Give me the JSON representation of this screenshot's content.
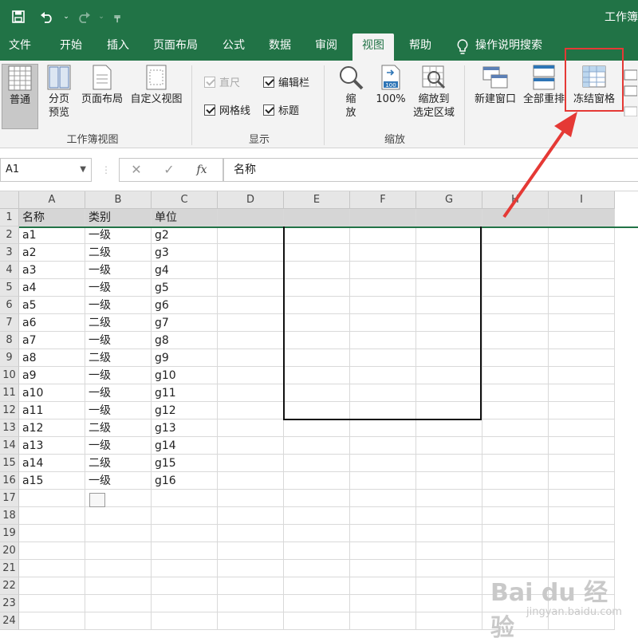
{
  "title_bar": {
    "title": "工作簿"
  },
  "tabs": [
    "文件",
    "开始",
    "插入",
    "页面布局",
    "公式",
    "数据",
    "审阅",
    "视图",
    "帮助",
    "操作说明搜索"
  ],
  "ribbon": {
    "workbook_views": {
      "normal": "普通",
      "page_break": "分页\n预览",
      "page_layout": "页面布局",
      "custom": "自定义视图",
      "label": "工作簿视图"
    },
    "show": {
      "ruler": "直尺",
      "formula_bar": "编辑栏",
      "gridlines": "网格线",
      "headings": "标题",
      "label": "显示"
    },
    "zoom": {
      "zoom": "缩\n放",
      "hundred": "100%",
      "to_selection": "缩放到\n选定区域",
      "label": "缩放"
    },
    "window": {
      "new_window": "新建窗口",
      "arrange_all": "全部重排",
      "freeze_panes": "冻结窗格"
    }
  },
  "formula_bar": {
    "name_box": "A1",
    "cancel": "✕",
    "enter": "✓",
    "fx": "fx",
    "content": "名称"
  },
  "columns": [
    "A",
    "B",
    "C",
    "D",
    "E",
    "F",
    "G",
    "H",
    "I"
  ],
  "rows": [
    "1",
    "2",
    "3",
    "4",
    "5",
    "6",
    "7",
    "8",
    "9",
    "10",
    "11",
    "12",
    "13",
    "14",
    "15",
    "16",
    "17",
    "18",
    "19",
    "20",
    "21",
    "22",
    "23",
    "24"
  ],
  "table": [
    [
      "名称",
      "类别",
      "单位"
    ],
    [
      "a1",
      "一级",
      "g2"
    ],
    [
      "a2",
      "二级",
      "g3"
    ],
    [
      "a3",
      "一级",
      "g4"
    ],
    [
      "a4",
      "一级",
      "g5"
    ],
    [
      "a5",
      "一级",
      "g6"
    ],
    [
      "a6",
      "二级",
      "g7"
    ],
    [
      "a7",
      "一级",
      "g8"
    ],
    [
      "a8",
      "二级",
      "g9"
    ],
    [
      "a9",
      "一级",
      "g10"
    ],
    [
      "a10",
      "一级",
      "g11"
    ],
    [
      "a11",
      "一级",
      "g12"
    ],
    [
      "a12",
      "二级",
      "g13"
    ],
    [
      "a13",
      "一级",
      "g14"
    ],
    [
      "a14",
      "二级",
      "g15"
    ],
    [
      "a15",
      "一级",
      "g16"
    ]
  ],
  "watermark": {
    "big": "Bai du 经验",
    "small": "jingyan.baidu.com"
  },
  "colors": {
    "excel_green": "#217346",
    "annotation_red": "#e53935"
  }
}
